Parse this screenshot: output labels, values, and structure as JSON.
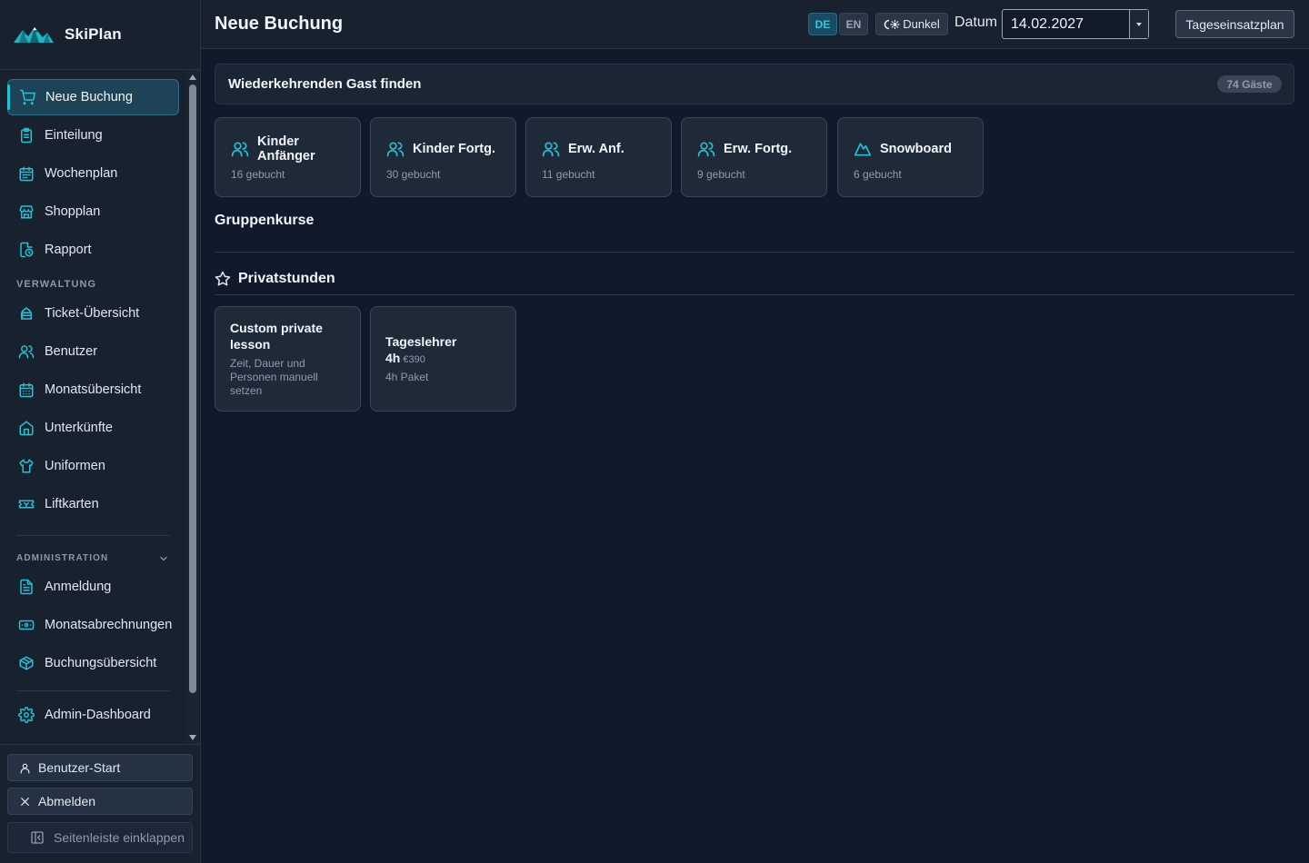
{
  "app": {
    "name": "SkiPlan"
  },
  "sidebar": {
    "main_items": [
      {
        "label": "Neue Buchung",
        "icon": "cart-icon",
        "active": true
      },
      {
        "label": "Einteilung",
        "icon": "clipboard-icon"
      },
      {
        "label": "Wochenplan",
        "icon": "calendar-icon"
      },
      {
        "label": "Shopplan",
        "icon": "store-icon"
      },
      {
        "label": "Rapport",
        "icon": "clock-report-icon"
      }
    ],
    "verwaltung_label": "VERWALTUNG",
    "verwaltung_items": [
      {
        "label": "Ticket-Übersicht",
        "icon": "ticket-icon"
      },
      {
        "label": "Benutzer",
        "icon": "users-icon"
      },
      {
        "label": "Monatsübersicht",
        "icon": "calendar-grid-icon"
      },
      {
        "label": "Unterkünfte",
        "icon": "home-icon"
      },
      {
        "label": "Uniformen",
        "icon": "shirt-icon"
      },
      {
        "label": "Liftkarten",
        "icon": "lift-ticket-icon"
      }
    ],
    "administration_label": "ADMINISTRATION",
    "administration_items": [
      {
        "label": "Anmeldung",
        "icon": "document-icon"
      },
      {
        "label": "Monatsabrechnungen",
        "icon": "banknote-icon"
      },
      {
        "label": "Buchungsübersicht",
        "icon": "package-icon"
      }
    ],
    "admin_dashboard": {
      "label": "Admin-Dashboard",
      "icon": "gear-icon"
    },
    "bottom": {
      "user_start": "Benutzer-Start",
      "logout": "Abmelden",
      "collapse": "Seitenleiste einklappen"
    }
  },
  "topbar": {
    "title": "Neue Buchung",
    "lang_de": "DE",
    "lang_en": "EN",
    "active_lang": "DE",
    "theme_label": "Dunkel",
    "datum_label": "Datum",
    "date_value": "14.02.2027",
    "day_plan_button": "Tageseinsatzplan"
  },
  "guest_search": {
    "title": "Wiederkehrenden Gast finden",
    "count_badge": "74 Gäste"
  },
  "courses": [
    {
      "label": "Kinder Anfänger",
      "line1": "Kinder",
      "line2": "Anfänger",
      "booked": "16 gebucht",
      "icon": "users-icon"
    },
    {
      "label": "Kinder Fortg.",
      "booked": "30 gebucht",
      "icon": "users-icon"
    },
    {
      "label": "Erw. Anf.",
      "booked": "11 gebucht",
      "icon": "users-icon"
    },
    {
      "label": "Erw. Fortg.",
      "booked": "9 gebucht",
      "icon": "users-icon"
    },
    {
      "label": "Snowboard",
      "booked": "6 gebucht",
      "icon": "mountain-icon"
    }
  ],
  "group_courses_title": "Gruppenkurse",
  "private_section": {
    "title": "Privatstunden",
    "cards": [
      {
        "title_line1": "Custom private",
        "title_line2": "lesson",
        "desc_line1": "Zeit, Dauer und",
        "desc_line2": "Personen manuell",
        "desc_line3": "setzen"
      },
      {
        "title": "Tageslehrer",
        "duration": "4h",
        "price": "€390",
        "package": "4h Paket"
      }
    ]
  },
  "colors": {
    "accent": "#22c3d6",
    "background": "#101a2b",
    "sidebar": "#18222f",
    "card": "#1f2a39"
  }
}
